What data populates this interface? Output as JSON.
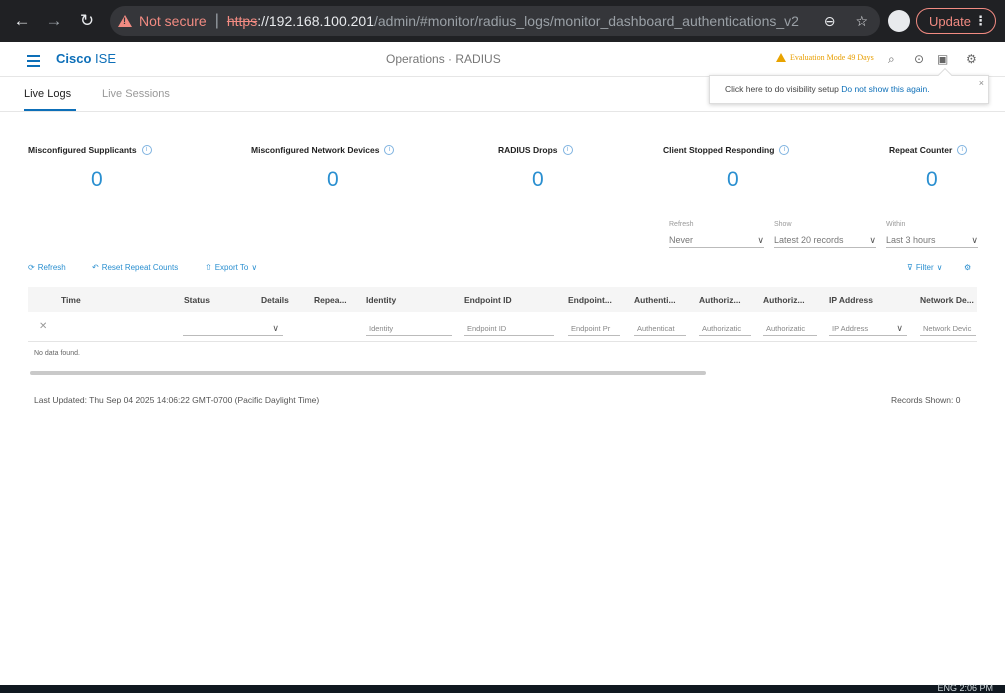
{
  "browser": {
    "not_secure": "Not secure",
    "url_scheme": "https",
    "url_host": "://192.168.100.201",
    "url_path": "/admin/#monitor/radius_logs/monitor_dashboard_authentications_v2",
    "update_label": "Update"
  },
  "header": {
    "brand_bold": "Cisco",
    "brand_light": "ISE",
    "page_title": "Operations · RADIUS",
    "eval_text": "Evaluation Mode 49 Days"
  },
  "tooltip": {
    "text": "Click here to do visibility setup ",
    "link": "Do not show this again."
  },
  "tabs": [
    "Live Logs",
    "Live Sessions"
  ],
  "stats": [
    {
      "label": "Misconfigured Supplicants",
      "value": "0"
    },
    {
      "label": "Misconfigured Network Devices",
      "value": "0"
    },
    {
      "label": "RADIUS Drops",
      "value": "0"
    },
    {
      "label": "Client Stopped Responding",
      "value": "0"
    },
    {
      "label": "Repeat Counter",
      "value": "0"
    }
  ],
  "filters": [
    {
      "label": "Refresh",
      "value": "Never"
    },
    {
      "label": "Show",
      "value": "Latest 20 records"
    },
    {
      "label": "Within",
      "value": "Last 3 hours"
    }
  ],
  "toolbar": {
    "refresh": "Refresh",
    "reset": "Reset Repeat Counts",
    "export": "Export To",
    "filter": "Filter"
  },
  "table": {
    "columns": [
      "Time",
      "Status",
      "Details",
      "Repea...",
      "Identity",
      "Endpoint ID",
      "Endpoint...",
      "Authenti...",
      "Authoriz...",
      "Authoriz...",
      "IP Address",
      "Network De..."
    ],
    "filter_placeholders": [
      "Identity",
      "Endpoint ID",
      "Endpoint Pr",
      "Authenticat",
      "Authorizatic",
      "Authorizatic",
      "IP Address",
      "Network Devic"
    ],
    "empty_text": "No data found."
  },
  "footer": {
    "last_updated": "Last Updated: Thu Sep 04 2025 14:06:22 GMT-0700 (Pacific Daylight Time)",
    "records_shown": "Records Shown: 0"
  },
  "taskbar": {
    "tray_text": "ENG   2:06 PM"
  },
  "colors": {
    "accent": "#0d6fb8",
    "stat_value": "#2a8fd0",
    "warning": "#e89e00",
    "insecure": "#f28b82"
  }
}
